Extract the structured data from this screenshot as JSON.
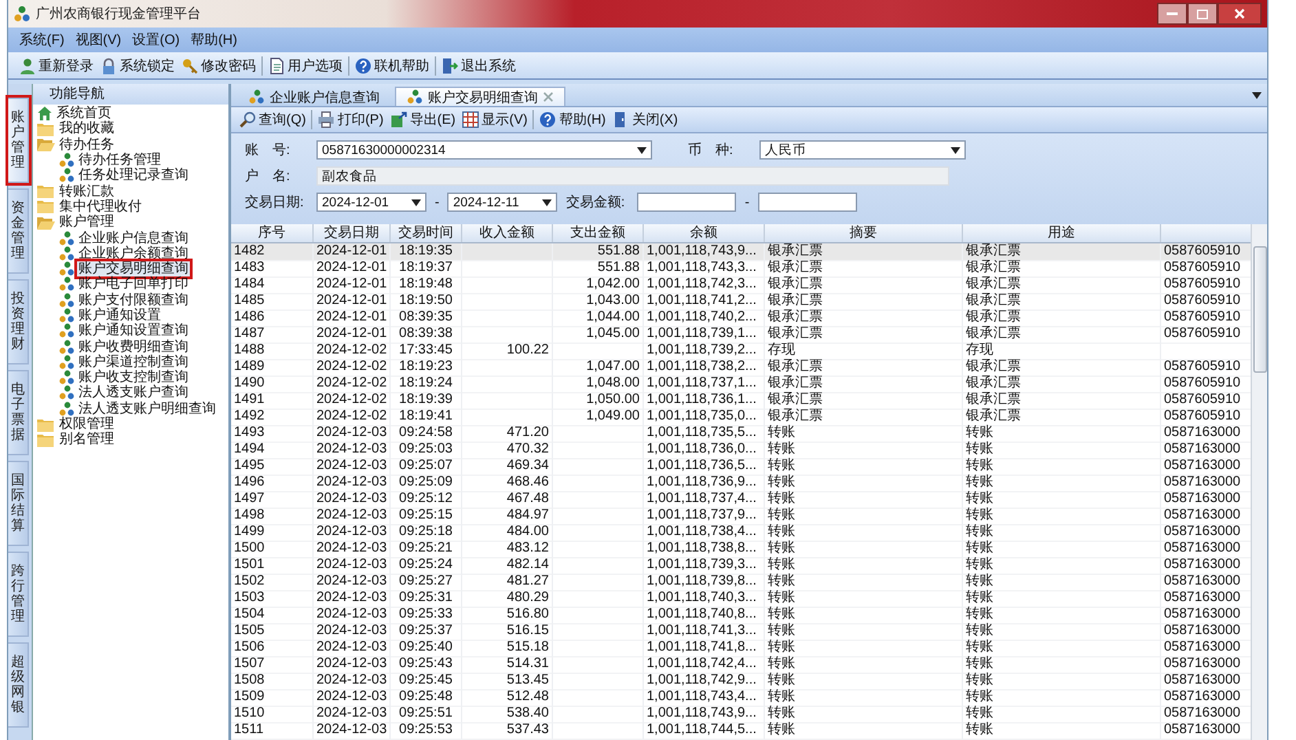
{
  "window": {
    "title": "广州农商银行现金管理平台"
  },
  "menu": [
    "系统(F)",
    "视图(V)",
    "设置(O)",
    "帮助(H)"
  ],
  "toolbar": [
    [
      "重新登录",
      "系统锁定",
      "修改密码"
    ],
    [
      "用户选项"
    ],
    [
      "联机帮助"
    ],
    [
      "退出系统"
    ]
  ],
  "nav": {
    "title": "功能导航",
    "tabs": [
      {
        "label": "账户管理",
        "selected": true,
        "highlighted": true
      },
      {
        "label": "资金管理",
        "selected": false,
        "highlighted": false
      },
      {
        "label": "投资理财",
        "selected": false,
        "highlighted": false
      },
      {
        "label": "电子票据",
        "selected": false,
        "highlighted": false
      },
      {
        "label": "国际结算",
        "selected": false,
        "highlighted": false
      },
      {
        "label": "跨行管理",
        "selected": false,
        "highlighted": false
      },
      {
        "label": "超级网银",
        "selected": false,
        "highlighted": false
      }
    ],
    "tree": [
      {
        "kind": "home",
        "label": "系统首页",
        "selected": false,
        "highlighted": false
      },
      {
        "kind": "folder",
        "label": "我的收藏",
        "expanded": false,
        "selected": false,
        "highlighted": false
      },
      {
        "kind": "folder",
        "label": "待办任务",
        "expanded": true,
        "selected": false,
        "highlighted": false,
        "children": [
          {
            "kind": "leaf",
            "label": "待办任务管理",
            "selected": false,
            "highlighted": false
          },
          {
            "kind": "leaf",
            "label": "任务处理记录查询",
            "selected": false,
            "highlighted": false
          }
        ]
      },
      {
        "kind": "folder",
        "label": "转账汇款",
        "expanded": false,
        "selected": false,
        "highlighted": false
      },
      {
        "kind": "folder",
        "label": "集中代理收付",
        "expanded": false,
        "selected": false,
        "highlighted": false
      },
      {
        "kind": "folder",
        "label": "账户管理",
        "expanded": true,
        "selected": false,
        "highlighted": false,
        "children": [
          {
            "kind": "leaf",
            "label": "企业账户信息查询",
            "selected": false,
            "highlighted": false
          },
          {
            "kind": "leaf",
            "label": "企业账户余额查询",
            "selected": false,
            "highlighted": false
          },
          {
            "kind": "leaf",
            "label": "账户交易明细查询",
            "selected": true,
            "highlighted": true
          },
          {
            "kind": "leaf",
            "label": "账户电子回单打印",
            "selected": false,
            "highlighted": false
          },
          {
            "kind": "leaf",
            "label": "账户支付限额查询",
            "selected": false,
            "highlighted": false
          },
          {
            "kind": "leaf",
            "label": "账户通知设置",
            "selected": false,
            "highlighted": false
          },
          {
            "kind": "leaf",
            "label": "账户通知设置查询",
            "selected": false,
            "highlighted": false
          },
          {
            "kind": "leaf",
            "label": "账户收费明细查询",
            "selected": false,
            "highlighted": false
          },
          {
            "kind": "leaf",
            "label": "账户渠道控制查询",
            "selected": false,
            "highlighted": false
          },
          {
            "kind": "leaf",
            "label": "账户收支控制查询",
            "selected": false,
            "highlighted": false
          },
          {
            "kind": "leaf",
            "label": "法人透支账户查询",
            "selected": false,
            "highlighted": false
          },
          {
            "kind": "leaf",
            "label": "法人透支账户明细查询",
            "selected": false,
            "highlighted": false
          }
        ]
      },
      {
        "kind": "folder",
        "label": "权限管理",
        "expanded": false,
        "selected": false,
        "highlighted": false
      },
      {
        "kind": "folder",
        "label": "别名管理",
        "expanded": false,
        "selected": false,
        "highlighted": false
      }
    ]
  },
  "doc_tabs": [
    {
      "label": "企业账户信息查询",
      "selected": false,
      "closable": false
    },
    {
      "label": "账户交易明细查询",
      "selected": true,
      "closable": true
    }
  ],
  "actions": [
    [
      "查询(Q)"
    ],
    [
      "打印(P)",
      "导出(E)",
      "显示(V)"
    ],
    [
      "帮助(H)",
      "关闭(X)"
    ]
  ],
  "form": {
    "account": {
      "label": "账　号:",
      "value": "05871630000002314"
    },
    "currency": {
      "label": "币　种:",
      "value": "人民币"
    },
    "holder": {
      "label": "户　名:",
      "value": "副农食品"
    },
    "date": {
      "label": "交易日期:",
      "from": "2024-12-01",
      "separator": "-",
      "to": "2024-12-11"
    },
    "amount": {
      "label": "交易金额:",
      "separator": "-"
    }
  },
  "table": {
    "columns": [
      "序号",
      "交易日期",
      "交易时间",
      "收入金额",
      "支出金额",
      "余额",
      "摘要",
      "用途"
    ],
    "rows": [
      {
        "selected": true,
        "cells": [
          "1482",
          "2024-12-01",
          "18:19:35",
          "",
          "551.88",
          "1,001,118,743,9...",
          "银承汇票",
          "银承汇票",
          "0587605910"
        ]
      },
      {
        "selected": false,
        "cells": [
          "1483",
          "2024-12-01",
          "18:19:37",
          "",
          "551.88",
          "1,001,118,743,3...",
          "银承汇票",
          "银承汇票",
          "0587605910"
        ]
      },
      {
        "selected": false,
        "cells": [
          "1484",
          "2024-12-01",
          "18:19:48",
          "",
          "1,042.00",
          "1,001,118,742,3...",
          "银承汇票",
          "银承汇票",
          "0587605910"
        ]
      },
      {
        "selected": false,
        "cells": [
          "1485",
          "2024-12-01",
          "18:19:50",
          "",
          "1,043.00",
          "1,001,118,741,2...",
          "银承汇票",
          "银承汇票",
          "0587605910"
        ]
      },
      {
        "selected": false,
        "cells": [
          "1486",
          "2024-12-01",
          "08:39:35",
          "",
          "1,044.00",
          "1,001,118,740,2...",
          "银承汇票",
          "银承汇票",
          "0587605910"
        ]
      },
      {
        "selected": false,
        "cells": [
          "1487",
          "2024-12-01",
          "08:39:38",
          "",
          "1,045.00",
          "1,001,118,739,1...",
          "银承汇票",
          "银承汇票",
          "0587605910"
        ]
      },
      {
        "selected": false,
        "cells": [
          "1488",
          "2024-12-02",
          "17:33:45",
          "100.22",
          "",
          "1,001,118,739,2...",
          "存现",
          "存现",
          ""
        ]
      },
      {
        "selected": false,
        "cells": [
          "1489",
          "2024-12-02",
          "18:19:23",
          "",
          "1,047.00",
          "1,001,118,738,2...",
          "银承汇票",
          "银承汇票",
          "0587605910"
        ]
      },
      {
        "selected": false,
        "cells": [
          "1490",
          "2024-12-02",
          "18:19:24",
          "",
          "1,048.00",
          "1,001,118,737,1...",
          "银承汇票",
          "银承汇票",
          "0587605910"
        ]
      },
      {
        "selected": false,
        "cells": [
          "1491",
          "2024-12-02",
          "18:19:39",
          "",
          "1,050.00",
          "1,001,118,736,1...",
          "银承汇票",
          "银承汇票",
          "0587605910"
        ]
      },
      {
        "selected": false,
        "cells": [
          "1492",
          "2024-12-02",
          "18:19:41",
          "",
          "1,049.00",
          "1,001,118,735,0...",
          "银承汇票",
          "银承汇票",
          "0587605910"
        ]
      },
      {
        "selected": false,
        "cells": [
          "1493",
          "2024-12-03",
          "09:24:58",
          "471.20",
          "",
          "1,001,118,735,5...",
          "转账",
          "转账",
          "0587163000"
        ]
      },
      {
        "selected": false,
        "cells": [
          "1494",
          "2024-12-03",
          "09:25:03",
          "470.32",
          "",
          "1,001,118,736,0...",
          "转账",
          "转账",
          "0587163000"
        ]
      },
      {
        "selected": false,
        "cells": [
          "1495",
          "2024-12-03",
          "09:25:07",
          "469.34",
          "",
          "1,001,118,736,5...",
          "转账",
          "转账",
          "0587163000"
        ]
      },
      {
        "selected": false,
        "cells": [
          "1496",
          "2024-12-03",
          "09:25:09",
          "468.46",
          "",
          "1,001,118,736,9...",
          "转账",
          "转账",
          "0587163000"
        ]
      },
      {
        "selected": false,
        "cells": [
          "1497",
          "2024-12-03",
          "09:25:12",
          "467.48",
          "",
          "1,001,118,737,4...",
          "转账",
          "转账",
          "0587163000"
        ]
      },
      {
        "selected": false,
        "cells": [
          "1498",
          "2024-12-03",
          "09:25:15",
          "484.97",
          "",
          "1,001,118,737,9...",
          "转账",
          "转账",
          "0587163000"
        ]
      },
      {
        "selected": false,
        "cells": [
          "1499",
          "2024-12-03",
          "09:25:18",
          "484.00",
          "",
          "1,001,118,738,4...",
          "转账",
          "转账",
          "0587163000"
        ]
      },
      {
        "selected": false,
        "cells": [
          "1500",
          "2024-12-03",
          "09:25:21",
          "483.12",
          "",
          "1,001,118,738,8...",
          "转账",
          "转账",
          "0587163000"
        ]
      },
      {
        "selected": false,
        "cells": [
          "1501",
          "2024-12-03",
          "09:25:24",
          "482.14",
          "",
          "1,001,118,739,3...",
          "转账",
          "转账",
          "0587163000"
        ]
      },
      {
        "selected": false,
        "cells": [
          "1502",
          "2024-12-03",
          "09:25:27",
          "481.27",
          "",
          "1,001,118,739,8...",
          "转账",
          "转账",
          "0587163000"
        ]
      },
      {
        "selected": false,
        "cells": [
          "1503",
          "2024-12-03",
          "09:25:31",
          "480.29",
          "",
          "1,001,118,740,3...",
          "转账",
          "转账",
          "0587163000"
        ]
      },
      {
        "selected": false,
        "cells": [
          "1504",
          "2024-12-03",
          "09:25:33",
          "516.80",
          "",
          "1,001,118,740,8...",
          "转账",
          "转账",
          "0587163000"
        ]
      },
      {
        "selected": false,
        "cells": [
          "1505",
          "2024-12-03",
          "09:25:37",
          "516.15",
          "",
          "1,001,118,741,3...",
          "转账",
          "转账",
          "0587163000"
        ]
      },
      {
        "selected": false,
        "cells": [
          "1506",
          "2024-12-03",
          "09:25:40",
          "515.18",
          "",
          "1,001,118,741,8...",
          "转账",
          "转账",
          "0587163000"
        ]
      },
      {
        "selected": false,
        "cells": [
          "1507",
          "2024-12-03",
          "09:25:43",
          "514.31",
          "",
          "1,001,118,742,4...",
          "转账",
          "转账",
          "0587163000"
        ]
      },
      {
        "selected": false,
        "cells": [
          "1508",
          "2024-12-03",
          "09:25:45",
          "513.45",
          "",
          "1,001,118,742,9...",
          "转账",
          "转账",
          "0587163000"
        ]
      },
      {
        "selected": false,
        "cells": [
          "1509",
          "2024-12-03",
          "09:25:48",
          "512.48",
          "",
          "1,001,118,743,4...",
          "转账",
          "转账",
          "0587163000"
        ]
      },
      {
        "selected": false,
        "cells": [
          "1510",
          "2024-12-03",
          "09:25:51",
          "538.40",
          "",
          "1,001,118,743,9...",
          "转账",
          "转账",
          "0587163000"
        ]
      },
      {
        "selected": false,
        "cells": [
          "1511",
          "2024-12-03",
          "09:25:53",
          "537.43",
          "",
          "1,001,118,744,5...",
          "转账",
          "转账",
          "0587163000"
        ]
      }
    ]
  }
}
